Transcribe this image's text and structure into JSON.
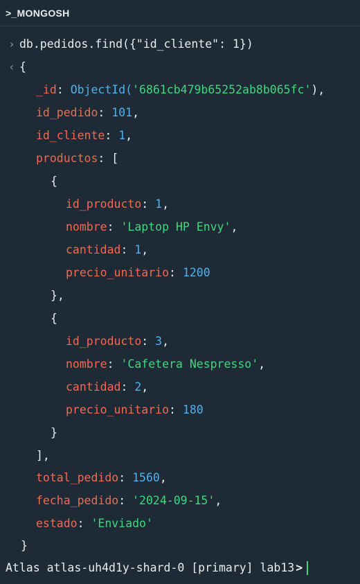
{
  "header": {
    "title": ">_MONGOSH"
  },
  "command": "db.pedidos.find({\"id_cliente\": 1})",
  "gutter": {
    "input": "›",
    "output": "‹"
  },
  "result": {
    "open": "{",
    "id_key": "_id",
    "id_fn": "ObjectId(",
    "id_value": "'6861cb479b65252ab8b065fc'",
    "id_close": "),",
    "id_pedido_key": "id_pedido",
    "id_pedido_value": "101",
    "id_cliente_key": "id_cliente",
    "id_cliente_value": "1",
    "productos_key": "productos",
    "productos_open": "[",
    "productos": [
      {
        "open": "{",
        "id_producto_key": "id_producto",
        "id_producto_value": "1",
        "nombre_key": "nombre",
        "nombre_value": "'Laptop HP Envy'",
        "cantidad_key": "cantidad",
        "cantidad_value": "1",
        "precio_key": "precio_unitario",
        "precio_value": "1200",
        "close": "},"
      },
      {
        "open": "{",
        "id_producto_key": "id_producto",
        "id_producto_value": "3",
        "nombre_key": "nombre",
        "nombre_value": "'Cafetera Nespresso'",
        "cantidad_key": "cantidad",
        "cantidad_value": "2",
        "precio_key": "precio_unitario",
        "precio_value": "180",
        "close": "}"
      }
    ],
    "productos_close": "],",
    "total_key": "total_pedido",
    "total_value": "1560",
    "fecha_key": "fecha_pedido",
    "fecha_value": "'2024-09-15'",
    "estado_key": "estado",
    "estado_value": "'Enviado'",
    "close": "}"
  },
  "prompt": {
    "text": "Atlas atlas-uh4d1y-shard-0 [primary] lab13",
    "caret": ">"
  },
  "colors": {
    "background": "#1e2a35",
    "key": "#f26a4f",
    "number": "#4eb3f0",
    "string": "#3fd87e",
    "cursor": "#3fd87e"
  }
}
